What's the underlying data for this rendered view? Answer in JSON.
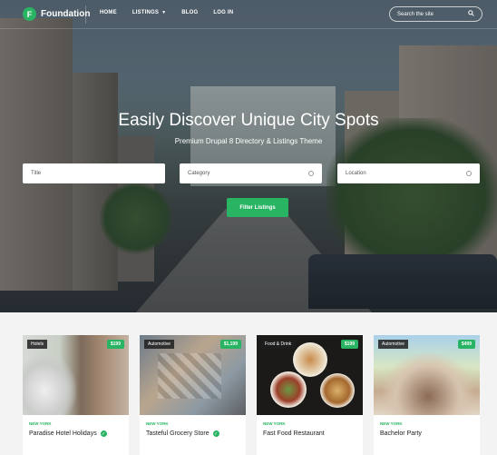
{
  "brand": {
    "name": "Foundation",
    "logo_letter": "F",
    "accent": "#28b463"
  },
  "nav": {
    "items": [
      {
        "label": "HOME"
      },
      {
        "label": "LISTINGS",
        "has_dropdown": true
      },
      {
        "label": "BLOG"
      },
      {
        "label": "LOG IN"
      }
    ],
    "search_placeholder": "Search the site"
  },
  "hero": {
    "title": "Easily Discover Unique City Spots",
    "subtitle": "Premium Drupal 8 Directory & Listings Theme"
  },
  "filters": {
    "title_placeholder": "Title",
    "category_placeholder": "Category",
    "location_placeholder": "Location",
    "button_label": "Filter Listings"
  },
  "listings": [
    {
      "category": "Hotels",
      "price": "$199",
      "city": "NEW YORK",
      "title": "Paradise Hotel Holidays",
      "verified": true
    },
    {
      "category": "Automotive",
      "price": "$1,199",
      "city": "NEW YORK",
      "title": "Tasteful Grocery Store",
      "verified": true
    },
    {
      "category": "Food & Drink",
      "price": "$199",
      "city": "NEW YORK",
      "title": "Fast Food Restaurant",
      "verified": false
    },
    {
      "category": "Automotive",
      "price": "$499",
      "city": "NEW YORK",
      "title": "Bachelor Party",
      "verified": false
    }
  ]
}
